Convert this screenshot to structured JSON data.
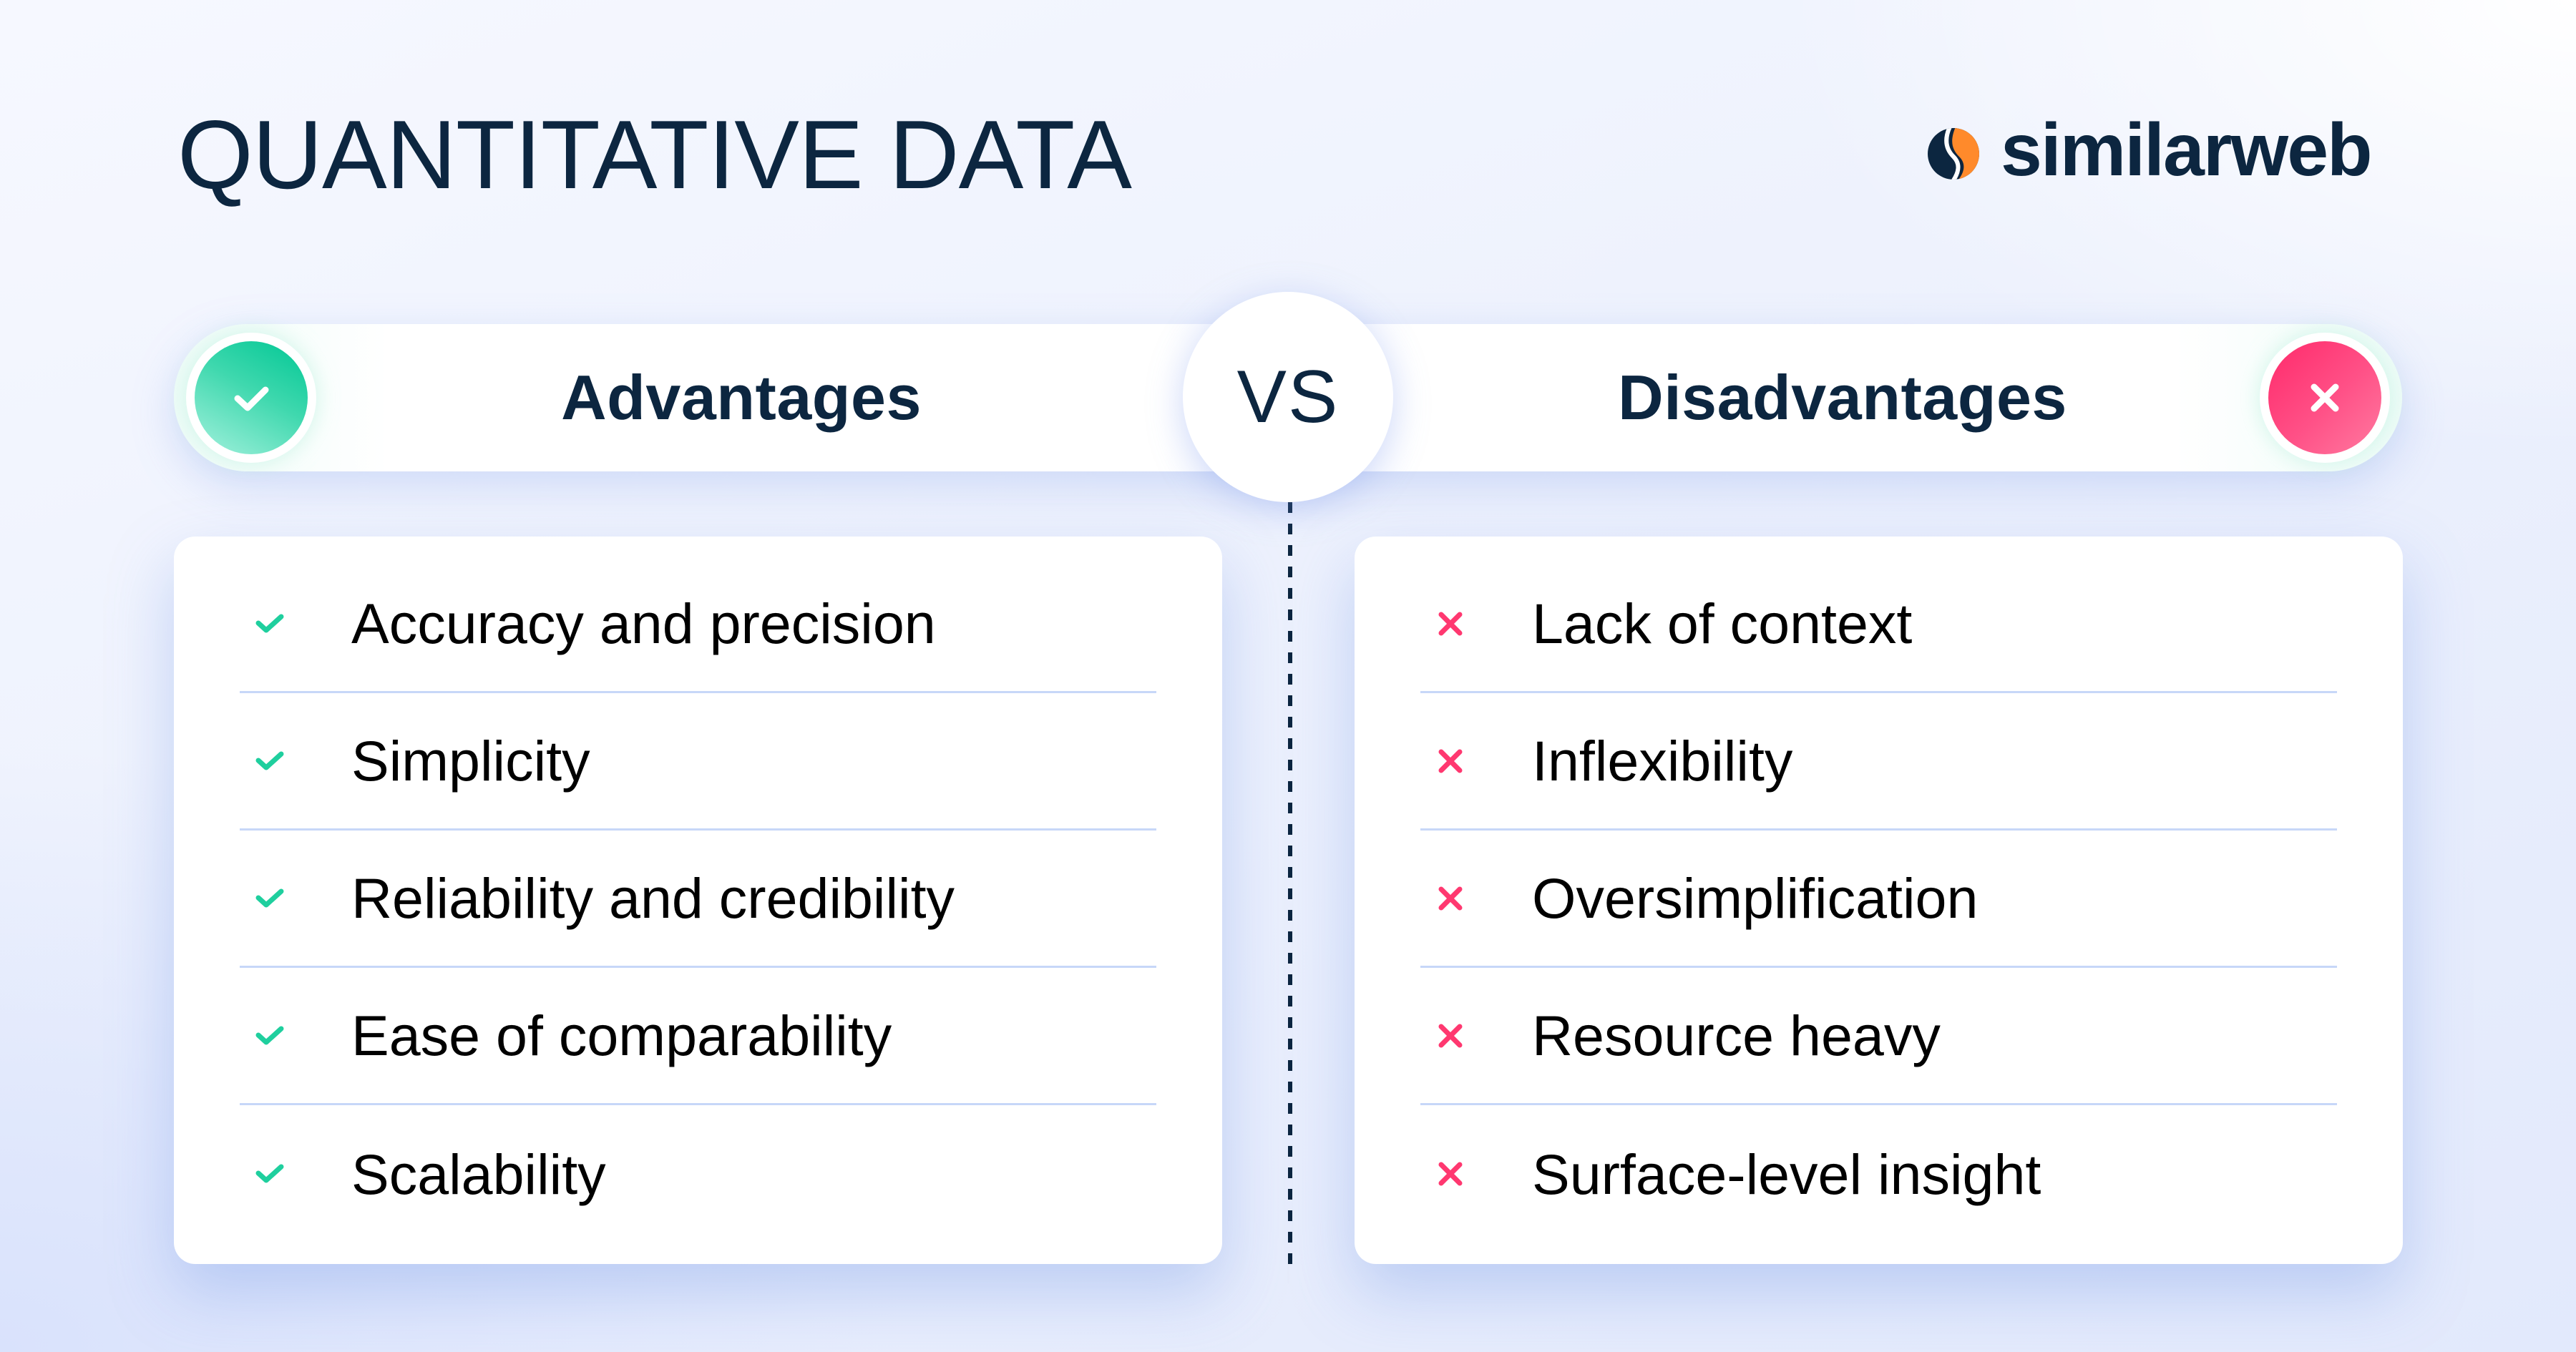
{
  "title": "QUANTITATIVE DATA",
  "brand": {
    "name": "similarweb",
    "colors": {
      "navy": "#0c2640",
      "orange": "#ff8a2b"
    }
  },
  "comparison": {
    "vs_label": "VS",
    "advantages": {
      "label": "Advantages",
      "icon": "check-icon",
      "accent": "#1fcf9e",
      "items": [
        {
          "text": "Accuracy and precision"
        },
        {
          "text": "Simplicity"
        },
        {
          "text": "Reliability and credibility"
        },
        {
          "text": "Ease of comparability"
        },
        {
          "text": "Scalability"
        }
      ]
    },
    "disadvantages": {
      "label": "Disadvantages",
      "icon": "x-icon",
      "accent": "#ff3870",
      "items": [
        {
          "text": "Lack of context"
        },
        {
          "text": "Inflexibility"
        },
        {
          "text": "Oversimplification"
        },
        {
          "text": "Resource heavy"
        },
        {
          "text": "Surface-level insight"
        }
      ]
    }
  }
}
